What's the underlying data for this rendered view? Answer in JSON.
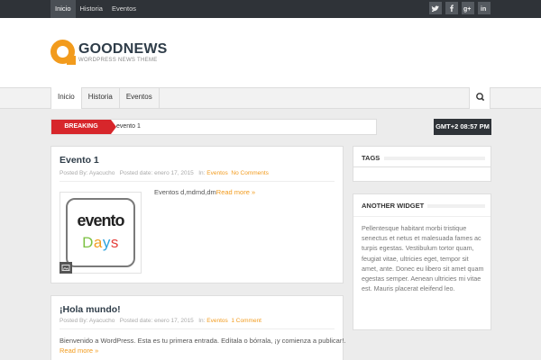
{
  "topnav": {
    "items": [
      "Inicio",
      "Historia",
      "Eventos"
    ]
  },
  "social": [
    "t",
    "f",
    "g+",
    "in"
  ],
  "logo": {
    "title": "GOODNEWS",
    "subtitle": "WORDPRESS NEWS THEME"
  },
  "mainnav": {
    "items": [
      "Inicio",
      "Historia",
      "Eventos"
    ]
  },
  "breaking": {
    "label": "BREAKING",
    "text": "evento 1"
  },
  "clock": "GMT+2 08:57 PM",
  "posts": [
    {
      "title": "Evento 1",
      "meta": {
        "posted_by_label": "Posted By:",
        "author": "Ayacucho",
        "date_label": "Posted date:",
        "date": "enero 17, 2015",
        "in_label": "In:",
        "category": "Eventos",
        "comments": "No Comments"
      },
      "thumb": {
        "line1": "evento",
        "line2": [
          "D",
          "a",
          "y",
          "s"
        ]
      },
      "excerpt": "Eventos d,mdmd,dm",
      "more": "Read more »"
    },
    {
      "title": "¡Hola mundo!",
      "meta": {
        "posted_by_label": "Posted By:",
        "author": "Ayacucho",
        "date_label": "Posted date:",
        "date": "enero 17, 2015",
        "in_label": "In:",
        "category": "Eventos",
        "comments": "1 Comment"
      },
      "excerpt": "Bienvenido a WordPress. Esta es tu primera entrada. Edítala o bórrala, ¡y comienza a publicar!.",
      "more": "Read more »"
    }
  ],
  "widgets": {
    "tags_title": "TAGS",
    "another_title": "ANOTHER WIDGET",
    "another_text": "Pellentesque habitant morbi tristique senectus et netus et malesuada fames ac turpis egestas. Vestibulum tortor quam, feugiat vitae, ultricies eget, tempor sit amet, ante. Donec eu libero sit amet quam egestas semper. Aenean ultricies mi vitae est. Mauris placerat eleifend leo."
  },
  "colors": {
    "accent": "#f29b1d",
    "breaking": "#d7262b",
    "dark": "#2f3338"
  }
}
